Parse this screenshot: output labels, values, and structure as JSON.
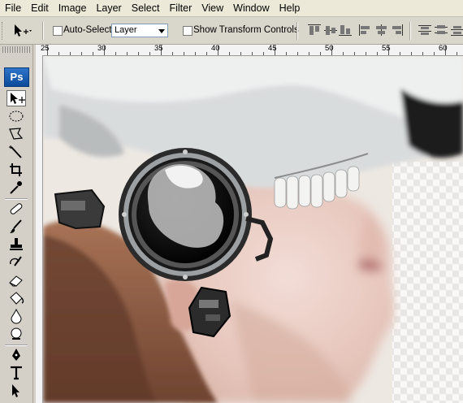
{
  "menu": [
    "File",
    "Edit",
    "Image",
    "Layer",
    "Select",
    "Filter",
    "View",
    "Window",
    "Help"
  ],
  "options": {
    "auto_select_label": "Auto-Select:",
    "auto_select_value": "Layer",
    "show_transform_label": "Show Transform Controls"
  },
  "ruler": {
    "labels": [
      "25",
      "30",
      "35",
      "40",
      "45",
      "50",
      "55",
      "60"
    ]
  },
  "tools": {
    "logo": "Ps"
  }
}
